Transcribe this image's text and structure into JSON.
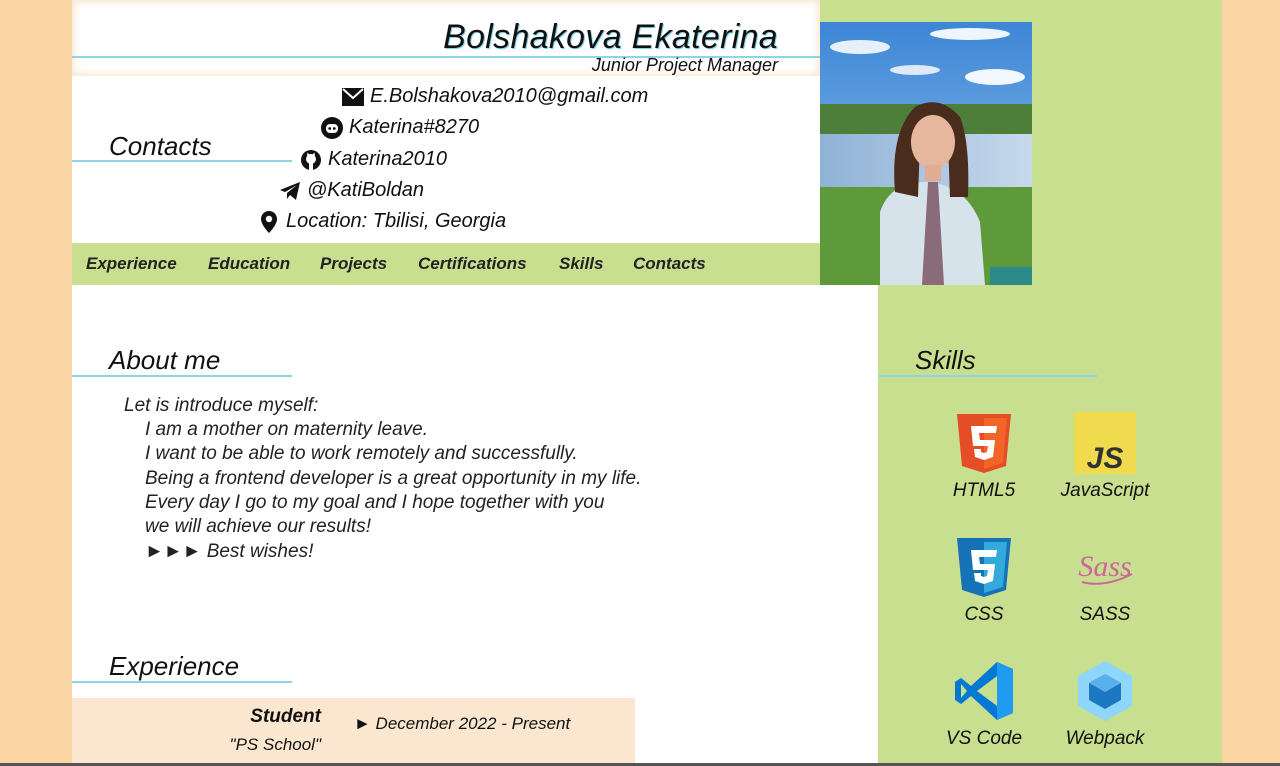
{
  "header": {
    "name": "Bolshakova  Ekaterina",
    "role": "Junior Project Manager"
  },
  "contacts": {
    "title": "Contacts",
    "items": [
      {
        "icon": "email-icon",
        "text": "E.Bolshakova2010@gmail.com"
      },
      {
        "icon": "discord-icon",
        "text": "Katerina#8270"
      },
      {
        "icon": "github-icon",
        "text": "Katerina2010"
      },
      {
        "icon": "telegram-icon",
        "text": "@KatiBoldan"
      },
      {
        "icon": "location-icon",
        "text": "Location: Tbilisi, Georgia"
      }
    ]
  },
  "nav": {
    "items": [
      "Experience",
      "Education",
      "Projects",
      "Certifications",
      "Skills",
      "Contacts"
    ]
  },
  "about": {
    "title": "About me",
    "intro": "Let is introduce myself:",
    "lines": [
      "I am a mother on maternity leave.",
      "I want to be able to work remotely and successfully.",
      "Being a frontend developer is a great opportunity in my life.",
      "Every day I go to my goal and I hope together with you",
      "we will achieve our results!",
      "►►► Best wishes!"
    ]
  },
  "experience": {
    "title": "Experience",
    "items": [
      {
        "position": "Student",
        "organization": "\"PS School\"",
        "period": "► December 2022 - Present"
      }
    ]
  },
  "skills": {
    "title": "Skills",
    "items": [
      {
        "icon": "html5-icon",
        "label": "HTML5"
      },
      {
        "icon": "javascript-icon",
        "label": "JavaScript"
      },
      {
        "icon": "css3-icon",
        "label": "CSS"
      },
      {
        "icon": "sass-icon",
        "label": "SASS"
      },
      {
        "icon": "vscode-icon",
        "label": "VS Code"
      },
      {
        "icon": "webpack-icon",
        "label": "Webpack"
      }
    ]
  },
  "colors": {
    "page_bg": "#fbd6a5",
    "accent_green": "#c8df8f",
    "underline_blue": "#8ed3e6",
    "card_bg": "#fbe7d0"
  }
}
